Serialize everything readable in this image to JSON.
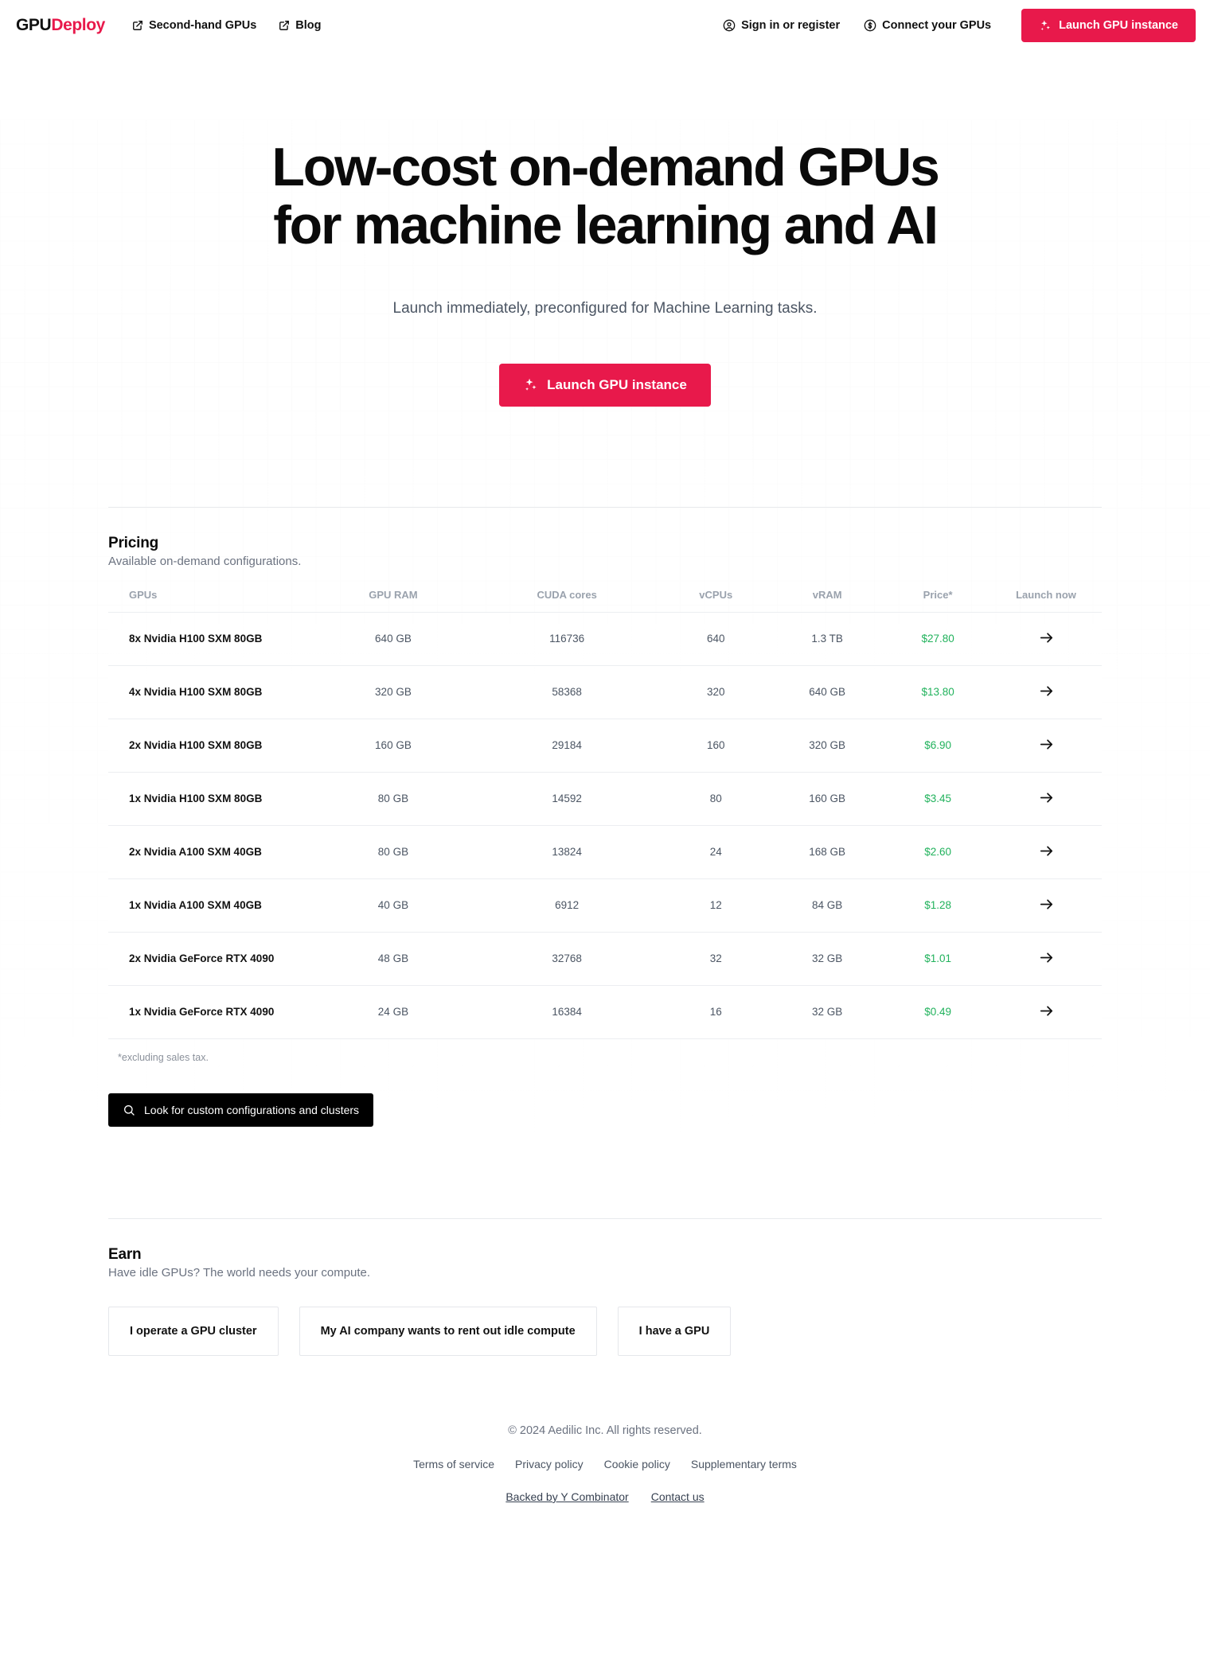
{
  "brand": {
    "logo_primary": "GPU",
    "logo_accent": "Deploy",
    "accent_color": "#e8194b"
  },
  "header": {
    "nav_left": [
      {
        "label": "Second-hand GPUs",
        "icon": "external-link-icon"
      },
      {
        "label": "Blog",
        "icon": "external-link-icon"
      }
    ],
    "nav_right": [
      {
        "label": "Sign in or register",
        "icon": "user-circle-icon"
      },
      {
        "label": "Connect your GPUs",
        "icon": "dollar-circle-icon"
      }
    ],
    "cta_label": "Launch GPU instance",
    "cta_icon": "sparkles-icon"
  },
  "hero": {
    "title_line1": "Low-cost on-demand GPUs",
    "title_line2": "for machine learning and AI",
    "subtitle": "Launch immediately, preconfigured for Machine Learning tasks.",
    "cta_label": "Launch GPU instance",
    "cta_icon": "sparkles-icon"
  },
  "pricing": {
    "title": "Pricing",
    "description": "Available on-demand configurations.",
    "columns": [
      "GPUs",
      "GPU RAM",
      "CUDA cores",
      "vCPUs",
      "vRAM",
      "Price*",
      "Launch now"
    ],
    "rows": [
      {
        "gpus": "8x Nvidia H100 SXM 80GB",
        "gpu_ram": "640 GB",
        "cuda_cores": "116736",
        "vcpus": "640",
        "vram": "1.3 TB",
        "price": "$27.80",
        "launch_icon": "arrow-right-icon"
      },
      {
        "gpus": "4x Nvidia H100 SXM 80GB",
        "gpu_ram": "320 GB",
        "cuda_cores": "58368",
        "vcpus": "320",
        "vram": "640 GB",
        "price": "$13.80",
        "launch_icon": "arrow-right-icon"
      },
      {
        "gpus": "2x Nvidia H100 SXM 80GB",
        "gpu_ram": "160 GB",
        "cuda_cores": "29184",
        "vcpus": "160",
        "vram": "320 GB",
        "price": "$6.90",
        "launch_icon": "arrow-right-icon"
      },
      {
        "gpus": "1x Nvidia H100 SXM 80GB",
        "gpu_ram": "80 GB",
        "cuda_cores": "14592",
        "vcpus": "80",
        "vram": "160 GB",
        "price": "$3.45",
        "launch_icon": "arrow-right-icon"
      },
      {
        "gpus": "2x Nvidia A100 SXM 40GB",
        "gpu_ram": "80 GB",
        "cuda_cores": "13824",
        "vcpus": "24",
        "vram": "168 GB",
        "price": "$2.60",
        "launch_icon": "arrow-right-icon"
      },
      {
        "gpus": "1x Nvidia A100 SXM 40GB",
        "gpu_ram": "40 GB",
        "cuda_cores": "6912",
        "vcpus": "12",
        "vram": "84 GB",
        "price": "$1.28",
        "launch_icon": "arrow-right-icon"
      },
      {
        "gpus": "2x Nvidia GeForce RTX 4090",
        "gpu_ram": "48 GB",
        "cuda_cores": "32768",
        "vcpus": "32",
        "vram": "32 GB",
        "price": "$1.01",
        "launch_icon": "arrow-right-icon"
      },
      {
        "gpus": "1x Nvidia GeForce RTX 4090",
        "gpu_ram": "24 GB",
        "cuda_cores": "16384",
        "vcpus": "16",
        "vram": "32 GB",
        "price": "$0.49",
        "launch_icon": "arrow-right-icon"
      }
    ],
    "footnote": "*excluding sales tax.",
    "search_button_label": "Look for custom configurations and clusters",
    "search_button_icon": "search-icon",
    "price_color": "#21b25c"
  },
  "earn": {
    "title": "Earn",
    "description": "Have idle GPUs? The world needs your compute.",
    "cards": [
      {
        "label": "I operate a GPU cluster"
      },
      {
        "label": "My AI company wants to rent out idle compute"
      },
      {
        "label": "I have a GPU"
      }
    ]
  },
  "footer": {
    "copyright": "© 2024 Aedilic Inc. All rights reserved.",
    "policy_links": [
      {
        "label": "Terms of service"
      },
      {
        "label": "Privacy policy"
      },
      {
        "label": "Cookie policy"
      },
      {
        "label": "Supplementary terms"
      }
    ],
    "extra_links": [
      {
        "label": "Backed by Y Combinator"
      },
      {
        "label": "Contact us"
      }
    ]
  }
}
